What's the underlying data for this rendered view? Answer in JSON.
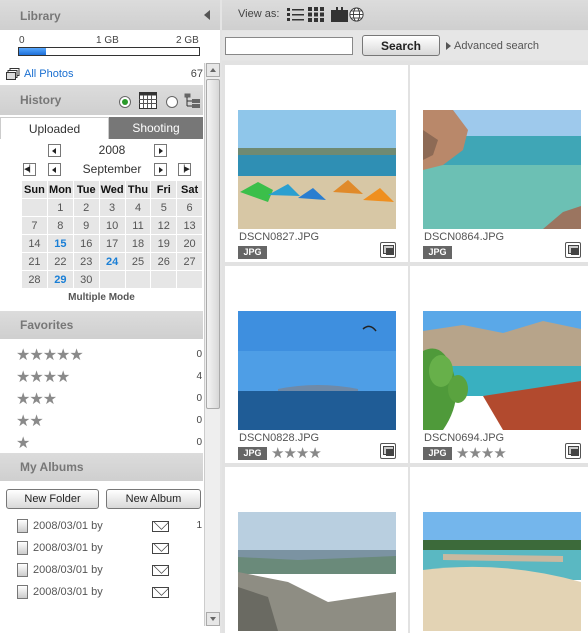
{
  "library": {
    "title": "Library",
    "storage": {
      "min_label": "0",
      "mid_label": "1 GB",
      "max_label": "2 GB",
      "used_fraction": 0.15
    }
  },
  "all_photos": {
    "label": "All Photos",
    "count": "67"
  },
  "history": {
    "title": "History",
    "tabs": [
      "Uploaded",
      "Shooting"
    ],
    "calendar": {
      "year": "2008",
      "month": "September",
      "weekdays": [
        "Sun",
        "Mon",
        "Tue",
        "Wed",
        "Thu",
        "Fri",
        "Sat"
      ],
      "weeks": [
        [
          "",
          "1",
          "2",
          "3",
          "4",
          "5",
          "6"
        ],
        [
          "7",
          "8",
          "9",
          "10",
          "11",
          "12",
          "13"
        ],
        [
          "14",
          "15",
          "16",
          "17",
          "18",
          "19",
          "20"
        ],
        [
          "21",
          "22",
          "23",
          "24",
          "25",
          "26",
          "27"
        ],
        [
          "28",
          "29",
          "30",
          "",
          "",
          "",
          ""
        ]
      ],
      "highlighted_days": [
        "15",
        "24",
        "29"
      ],
      "mode_label": "Multiple Mode"
    }
  },
  "favorites": {
    "title": "Favorites",
    "rows": [
      {
        "stars": "★★★★★",
        "count": "0"
      },
      {
        "stars": "★★★★",
        "count": "4"
      },
      {
        "stars": "★★★",
        "count": "0"
      },
      {
        "stars": "★★",
        "count": "0"
      },
      {
        "stars": "★",
        "count": "0"
      }
    ]
  },
  "albums": {
    "title": "My Albums",
    "new_folder": "New Folder",
    "new_album": "New Album",
    "rows": [
      {
        "label": "2008/03/01 by",
        "count": "1"
      },
      {
        "label": "2008/03/01 by",
        "count": ""
      },
      {
        "label": "2008/03/01 by",
        "count": ""
      },
      {
        "label": "2008/03/01 by",
        "count": ""
      }
    ]
  },
  "toolbar": {
    "view_as": "View as:",
    "search_value": "",
    "search_button": "Search",
    "advanced_search": "Advanced search"
  },
  "photos": [
    {
      "filename": "DSCN0827.JPG",
      "type": "JPG",
      "stars": ""
    },
    {
      "filename": "DSCN0864.JPG",
      "type": "JPG",
      "stars": ""
    },
    {
      "filename": "DSCN0828.JPG",
      "type": "JPG",
      "stars": "★★★★"
    },
    {
      "filename": "DSCN0694.JPG",
      "type": "JPG",
      "stars": "★★★★"
    },
    {
      "filename": "",
      "type": "",
      "stars": ""
    },
    {
      "filename": "",
      "type": "",
      "stars": ""
    }
  ]
}
